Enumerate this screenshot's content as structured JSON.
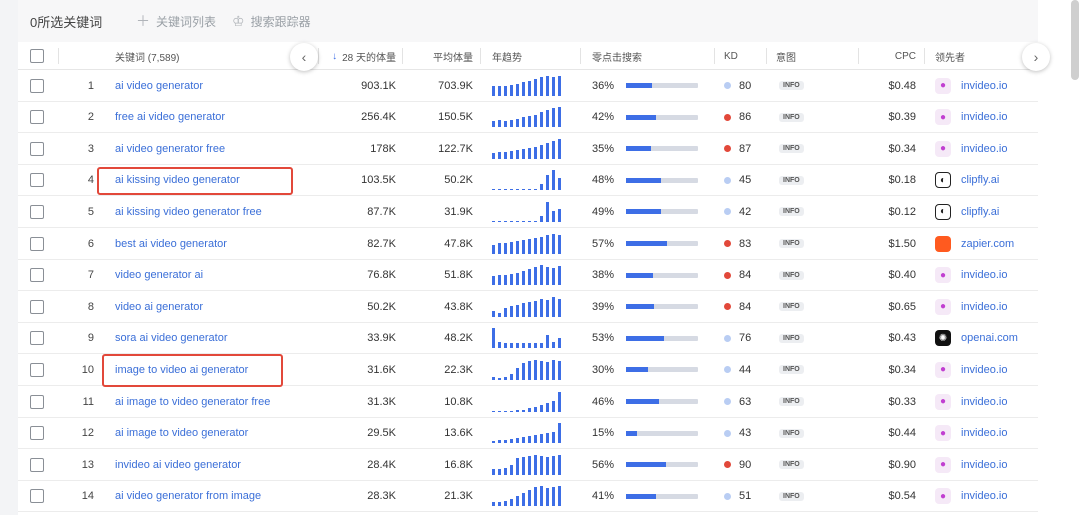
{
  "topbar": {
    "selected_count": "0所选关键词",
    "keyword_list": "关键词列表",
    "search_tracker": "搜索跟踪器"
  },
  "headers": {
    "keyword": "关键词 (7,589)",
    "volume28": "28 天的体量",
    "avg_volume": "平均体量",
    "trend": "年趋势",
    "zero_click": "零点击搜索",
    "kd": "KD",
    "intent": "意图",
    "cpc": "CPC",
    "leader": "领先者"
  },
  "colors": {
    "accent": "#3d6ee6",
    "kd_high": "#e2483a",
    "kd_low": "#b9cdf3",
    "highlight": "#e2483a"
  },
  "rows": [
    {
      "idx": "1",
      "keyword": "ai video generator",
      "vol": "903.1K",
      "avg": "703.9K",
      "trend": [
        0.5,
        0.5,
        0.5,
        0.55,
        0.6,
        0.7,
        0.75,
        0.85,
        0.95,
        1.0,
        0.95,
        1.0
      ],
      "zc": "36%",
      "zc_frac": 0.36,
      "kd": "80",
      "kd_level": "low",
      "intent": "INFO",
      "cpc": "$0.48",
      "leader": "invideo.io",
      "leader_icon": "invideo"
    },
    {
      "idx": "2",
      "keyword": "free ai video generator",
      "vol": "256.4K",
      "avg": "150.5K",
      "trend": [
        0.3,
        0.35,
        0.3,
        0.35,
        0.4,
        0.5,
        0.55,
        0.6,
        0.75,
        0.85,
        0.95,
        1.0
      ],
      "zc": "42%",
      "zc_frac": 0.42,
      "kd": "86",
      "kd_level": "high",
      "intent": "INFO",
      "cpc": "$0.39",
      "leader": "invideo.io",
      "leader_icon": "invideo"
    },
    {
      "idx": "3",
      "keyword": "ai video generator free",
      "vol": "178K",
      "avg": "122.7K",
      "trend": [
        0.3,
        0.35,
        0.35,
        0.4,
        0.45,
        0.5,
        0.55,
        0.6,
        0.7,
        0.8,
        0.9,
        1.0
      ],
      "zc": "35%",
      "zc_frac": 0.35,
      "kd": "87",
      "kd_level": "high",
      "intent": "INFO",
      "cpc": "$0.34",
      "leader": "invideo.io",
      "leader_icon": "invideo"
    },
    {
      "idx": "4",
      "keyword": "ai kissing video generator",
      "vol": "103.5K",
      "avg": "50.2K",
      "trend": [
        0.05,
        0.05,
        0.05,
        0.05,
        0.05,
        0.05,
        0.05,
        0.05,
        0.3,
        0.75,
        1.0,
        0.6
      ],
      "zc": "48%",
      "zc_frac": 0.48,
      "kd": "45",
      "kd_level": "low",
      "intent": "INFO",
      "cpc": "$0.18",
      "leader": "clipfly.ai",
      "leader_icon": "clipfly"
    },
    {
      "idx": "5",
      "keyword": "ai kissing video generator free",
      "vol": "87.7K",
      "avg": "31.9K",
      "trend": [
        0.05,
        0.05,
        0.05,
        0.05,
        0.05,
        0.05,
        0.05,
        0.05,
        0.3,
        1.0,
        0.55,
        0.65
      ],
      "zc": "49%",
      "zc_frac": 0.49,
      "kd": "42",
      "kd_level": "low",
      "intent": "INFO",
      "cpc": "$0.12",
      "leader": "clipfly.ai",
      "leader_icon": "clipfly"
    },
    {
      "idx": "6",
      "keyword": "best ai video generator",
      "vol": "82.7K",
      "avg": "47.8K",
      "trend": [
        0.45,
        0.55,
        0.55,
        0.6,
        0.65,
        0.7,
        0.75,
        0.8,
        0.85,
        0.95,
        1.0,
        0.95
      ],
      "zc": "57%",
      "zc_frac": 0.57,
      "kd": "83",
      "kd_level": "high",
      "intent": "INFO",
      "cpc": "$1.50",
      "leader": "zapier.com",
      "leader_icon": "zapier"
    },
    {
      "idx": "7",
      "keyword": "video generator ai",
      "vol": "76.8K",
      "avg": "51.8K",
      "trend": [
        0.45,
        0.5,
        0.5,
        0.55,
        0.6,
        0.7,
        0.8,
        0.9,
        1.0,
        0.9,
        0.85,
        0.95
      ],
      "zc": "38%",
      "zc_frac": 0.38,
      "kd": "84",
      "kd_level": "high",
      "intent": "INFO",
      "cpc": "$0.40",
      "leader": "invideo.io",
      "leader_icon": "invideo"
    },
    {
      "idx": "8",
      "keyword": "video ai generator",
      "vol": "50.2K",
      "avg": "43.8K",
      "trend": [
        0.3,
        0.2,
        0.45,
        0.55,
        0.6,
        0.7,
        0.75,
        0.8,
        0.9,
        0.85,
        1.0,
        0.9
      ],
      "zc": "39%",
      "zc_frac": 0.39,
      "kd": "84",
      "kd_level": "high",
      "intent": "INFO",
      "cpc": "$0.65",
      "leader": "invideo.io",
      "leader_icon": "invideo"
    },
    {
      "idx": "9",
      "keyword": "sora ai video generator",
      "vol": "33.9K",
      "avg": "48.2K",
      "trend": [
        1.0,
        0.3,
        0.25,
        0.25,
        0.25,
        0.25,
        0.25,
        0.25,
        0.25,
        0.65,
        0.3,
        0.5
      ],
      "zc": "53%",
      "zc_frac": 0.53,
      "kd": "76",
      "kd_level": "low",
      "intent": "INFO",
      "cpc": "$0.43",
      "leader": "openai.com",
      "leader_icon": "openai"
    },
    {
      "idx": "10",
      "keyword": "image to video ai generator",
      "vol": "31.6K",
      "avg": "22.3K",
      "trend": [
        0.15,
        0.1,
        0.15,
        0.3,
        0.6,
        0.85,
        0.95,
        1.0,
        0.95,
        0.9,
        1.0,
        0.95
      ],
      "zc": "30%",
      "zc_frac": 0.3,
      "kd": "44",
      "kd_level": "low",
      "intent": "INFO",
      "cpc": "$0.34",
      "leader": "invideo.io",
      "leader_icon": "invideo"
    },
    {
      "idx": "11",
      "keyword": "ai image to video generator free",
      "vol": "31.3K",
      "avg": "10.8K",
      "trend": [
        0.05,
        0.05,
        0.05,
        0.05,
        0.1,
        0.1,
        0.2,
        0.25,
        0.35,
        0.45,
        0.55,
        1.0
      ],
      "zc": "46%",
      "zc_frac": 0.46,
      "kd": "63",
      "kd_level": "low",
      "intent": "INFO",
      "cpc": "$0.33",
      "leader": "invideo.io",
      "leader_icon": "invideo"
    },
    {
      "idx": "12",
      "keyword": "ai image to video generator",
      "vol": "29.5K",
      "avg": "13.6K",
      "trend": [
        0.1,
        0.15,
        0.15,
        0.2,
        0.25,
        0.3,
        0.35,
        0.4,
        0.45,
        0.5,
        0.55,
        1.0
      ],
      "zc": "15%",
      "zc_frac": 0.15,
      "kd": "43",
      "kd_level": "low",
      "intent": "INFO",
      "cpc": "$0.44",
      "leader": "invideo.io",
      "leader_icon": "invideo"
    },
    {
      "idx": "13",
      "keyword": "invideo ai video generator",
      "vol": "28.4K",
      "avg": "16.8K",
      "trend": [
        0.3,
        0.3,
        0.35,
        0.5,
        0.85,
        0.9,
        0.95,
        1.0,
        0.95,
        0.9,
        0.95,
        1.0
      ],
      "zc": "56%",
      "zc_frac": 0.56,
      "kd": "90",
      "kd_level": "high",
      "intent": "INFO",
      "cpc": "$0.90",
      "leader": "invideo.io",
      "leader_icon": "invideo"
    },
    {
      "idx": "14",
      "keyword": "ai video generator from image",
      "vol": "28.3K",
      "avg": "21.3K",
      "trend": [
        0.2,
        0.2,
        0.25,
        0.35,
        0.5,
        0.65,
        0.8,
        0.95,
        1.0,
        0.9,
        0.95,
        1.0
      ],
      "zc": "41%",
      "zc_frac": 0.41,
      "kd": "51",
      "kd_level": "low",
      "intent": "INFO",
      "cpc": "$0.54",
      "leader": "invideo.io",
      "leader_icon": "invideo"
    }
  ]
}
